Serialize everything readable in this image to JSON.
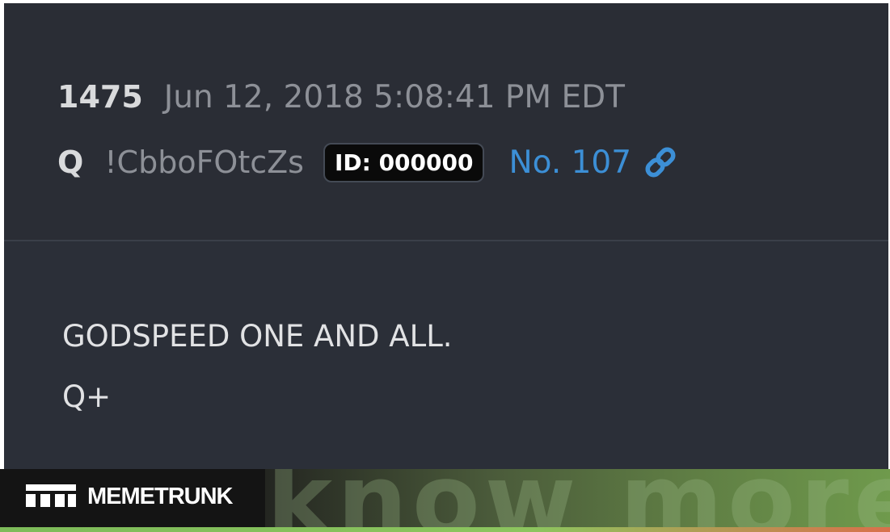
{
  "post": {
    "number": "1475",
    "timestamp": "Jun 12, 2018 5:08:41 PM EDT",
    "author": "Q",
    "tripcode": "!CbboFOtcZs",
    "id_badge": "ID: 000000",
    "post_link": "No. 107",
    "link_icon": "link-chain-icon",
    "body_lines": [
      "GODSPEED ONE AND ALL.",
      "Q+"
    ]
  },
  "footer": {
    "brand": "MEMETRUNK",
    "watermark": "know more",
    "logo_icon": "memetrunk-logo-icon"
  },
  "colors": {
    "card_bg": "#2b2f38",
    "post_link": "#3c8fd6",
    "id_badge_bg": "#0a0a0a"
  }
}
